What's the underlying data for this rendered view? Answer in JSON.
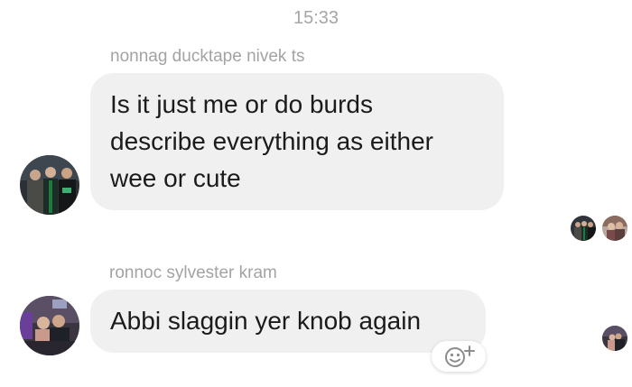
{
  "chat": {
    "timestamp": "15:33",
    "messages": [
      {
        "sender": "nonnag ducktape nivek ts",
        "lines": [
          "Is it just me or do burds",
          "describe everything as either",
          "wee or cute"
        ]
      },
      {
        "sender": "ronnoc sylvester kram",
        "lines": [
          "Abbi slaggin yer knob again"
        ]
      }
    ]
  },
  "icons": {
    "reaction": "smiley-plus-icon"
  },
  "colors": {
    "bubble": "#f0f0f0",
    "meta_text": "#a6a6a6",
    "message_text": "#1b1b1b",
    "background": "#ffffff"
  }
}
